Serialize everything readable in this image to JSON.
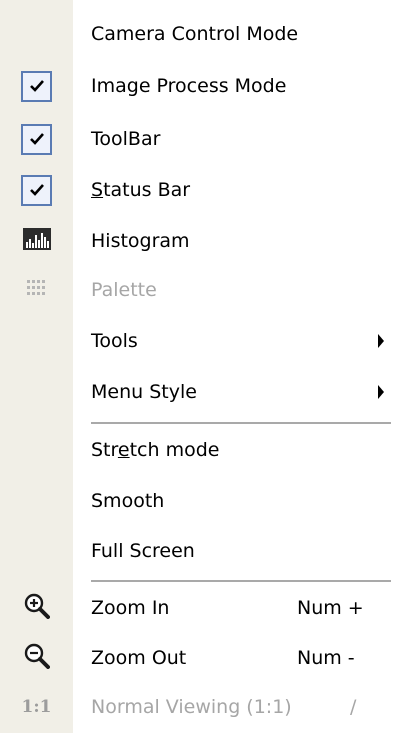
{
  "menu": {
    "items": [
      {
        "label": "Camera Control Mode"
      },
      {
        "label": "Image Process Mode",
        "checked": true
      },
      {
        "label": "ToolBar",
        "checked": true
      },
      {
        "label": "Status Bar",
        "checked": true,
        "mnemonic": "S"
      },
      {
        "label": "Histogram",
        "icon": "histogram-icon"
      },
      {
        "label": "Palette",
        "icon": "palette-grid-icon",
        "disabled": true
      },
      {
        "label": "Tools",
        "submenu": true
      },
      {
        "label": "Menu Style",
        "submenu": true
      },
      {
        "label": "Stretch mode",
        "mnemonic": "e"
      },
      {
        "label": "Smooth"
      },
      {
        "label": "Full Screen"
      },
      {
        "label": "Zoom In",
        "shortcut": "Num +",
        "icon": "zoom-in-icon"
      },
      {
        "label": "Zoom Out",
        "shortcut": "Num -",
        "icon": "zoom-out-icon"
      },
      {
        "label": "Normal Viewing (1:1)",
        "shortcut": "/",
        "icon": "one-to-one-icon",
        "icon_text": "1:1",
        "disabled": true
      }
    ]
  },
  "colors": {
    "gutter": "#f1efe7",
    "check_border": "#5a7bb3",
    "disabled_text": "#a6a6a6"
  }
}
